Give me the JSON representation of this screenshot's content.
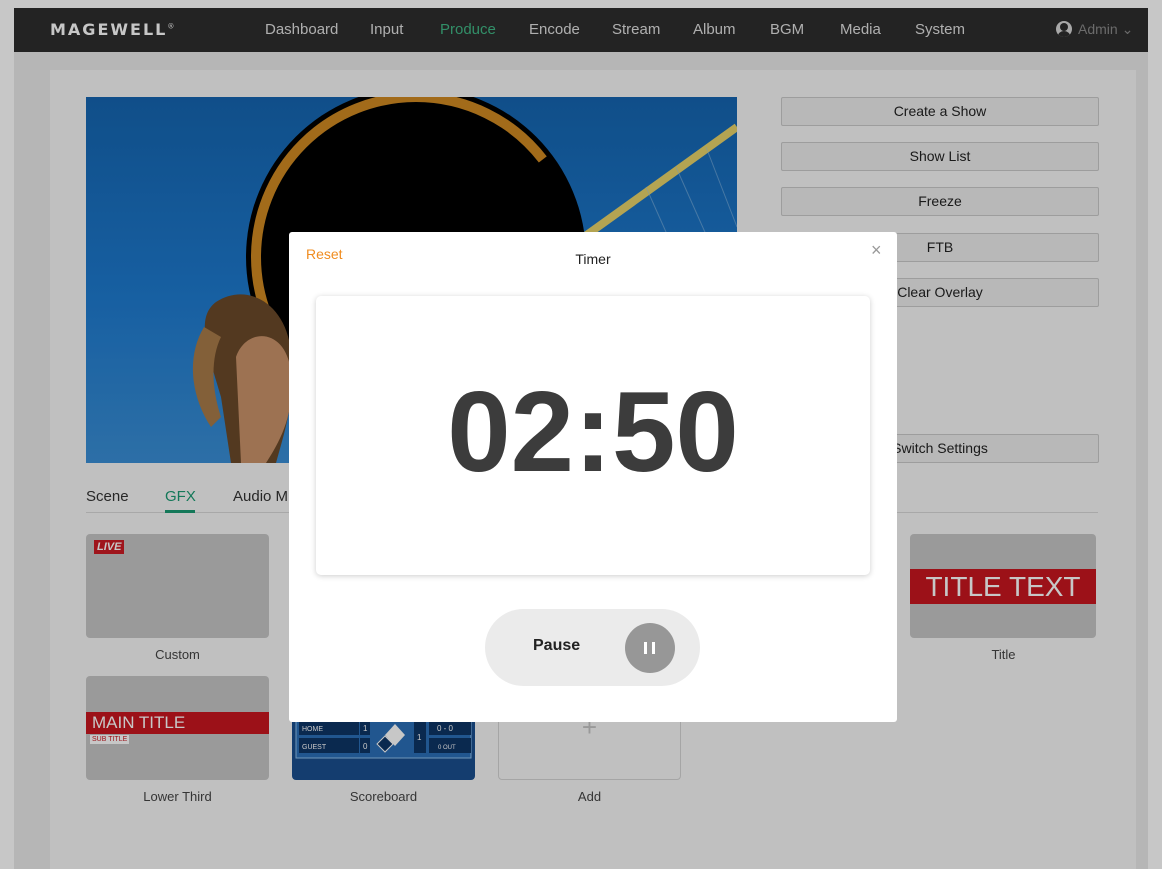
{
  "header": {
    "logo": "MAGEWELL",
    "nav": [
      "Dashboard",
      "Input",
      "Produce",
      "Encode",
      "Stream",
      "Album",
      "BGM",
      "Media",
      "System"
    ],
    "active_nav": "Produce",
    "user": "Admin"
  },
  "right_buttons": {
    "create_show": "Create a Show",
    "show_list": "Show List",
    "freeze": "Freeze",
    "ftb": "FTB",
    "clear_overlay": "Clear Overlay",
    "switch_settings": "Switch Settings"
  },
  "tabs": {
    "scene": "Scene",
    "gfx": "GFX",
    "audio": "Audio M"
  },
  "gfx_cards": {
    "custom_label": "Custom",
    "custom_badge": "LIVE",
    "title_label": "Title",
    "title_text": "TITLE TEXT",
    "lower_third_label": "Lower Third",
    "main_title": "MAIN TITLE",
    "sub_title": "SUB TITLE",
    "scoreboard_label": "Scoreboard",
    "home": "HOME",
    "guest": "GUEST",
    "home_score": "1",
    "guest_score": "0",
    "score_mid": "1",
    "set_score": "0 - 0",
    "outs": "0 OUT",
    "add_label": "Add",
    "add_icon": "+"
  },
  "modal": {
    "reset": "Reset",
    "title": "Timer",
    "close": "×",
    "time": "02:50",
    "pause_label": "Pause"
  },
  "colors": {
    "accent_green": "#1a9a72",
    "reset_orange": "#f08c1f",
    "gfx_red": "#c8171f"
  }
}
